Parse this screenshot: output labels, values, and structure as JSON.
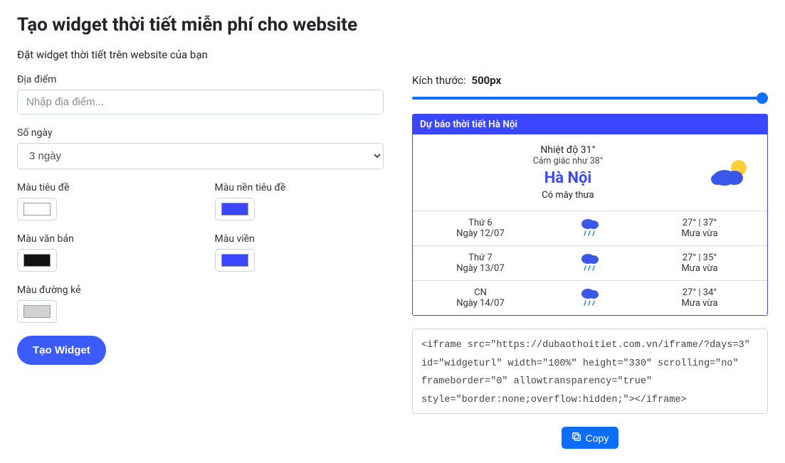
{
  "title": "Tạo widget thời tiết miễn phí cho website",
  "subtitle": "Đặt widget thời tiết trên website của bạn",
  "labels": {
    "location": "Địa điểm",
    "location_ph": "Nhập địa điểm...",
    "days": "Số ngày",
    "days_value": "3 ngày",
    "title_color": "Màu tiêu đề",
    "title_bg": "Màu nền tiêu đề",
    "text_color": "Màu văn bản",
    "border_color": "Màu viền",
    "line_color": "Màu đường kẻ",
    "create_btn": "Tạo Widget",
    "size_label": "Kích thước:",
    "size_value": "500px",
    "copy": "Copy"
  },
  "colors": {
    "title_color": "#ffffff",
    "title_bg": "#3b46ff",
    "text_color": "#111111",
    "border_color": "#3b46ff",
    "line_color": "#d2d2d2"
  },
  "widget": {
    "header": "Dự báo thời tiết Hà Nội",
    "temp": "Nhiệt độ 31°",
    "feels": "Cảm giác như 38°",
    "city": "Hà Nội",
    "condition": "Có mây thưa",
    "days": [
      {
        "name": "Thứ 6",
        "date": "Ngày 12/07",
        "temps": "27° | 37°",
        "cond": "Mưa vừa"
      },
      {
        "name": "Thứ 7",
        "date": "Ngày 13/07",
        "temps": "27° | 35°",
        "cond": "Mưa vừa"
      },
      {
        "name": "CN",
        "date": "Ngày 14/07",
        "temps": "27° | 34°",
        "cond": "Mưa vừa"
      }
    ]
  },
  "code": "<iframe src=\"https://dubaothoitiet.com.vn/iframe/?days=3\" id=\"widgeturl\" width=\"100%\" height=\"330\" scrolling=\"no\" frameborder=\"0\" allowtransparency=\"true\" style=\"border:none;overflow:hidden;\"></iframe>"
}
